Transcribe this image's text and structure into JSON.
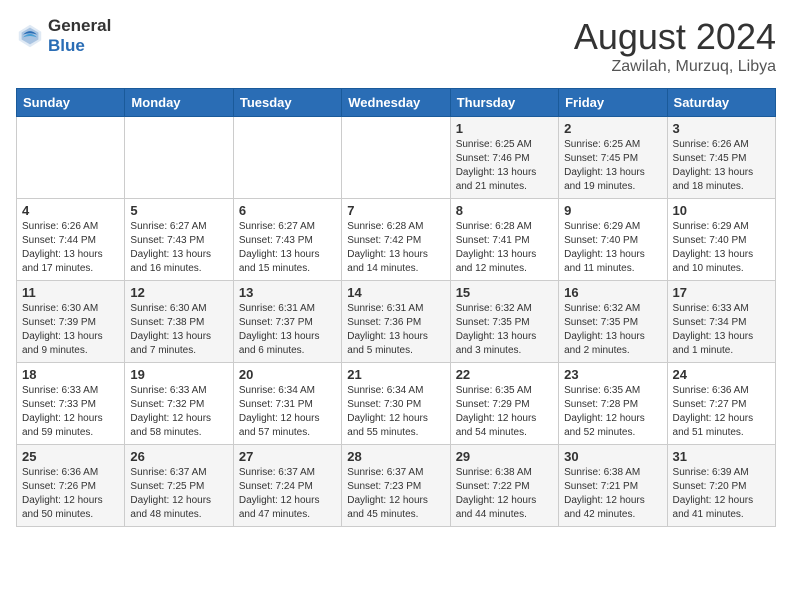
{
  "header": {
    "logo_general": "General",
    "logo_blue": "Blue",
    "month_year": "August 2024",
    "location": "Zawilah, Murzuq, Libya"
  },
  "days_of_week": [
    "Sunday",
    "Monday",
    "Tuesday",
    "Wednesday",
    "Thursday",
    "Friday",
    "Saturday"
  ],
  "weeks": [
    [
      {
        "day": "",
        "info": ""
      },
      {
        "day": "",
        "info": ""
      },
      {
        "day": "",
        "info": ""
      },
      {
        "day": "",
        "info": ""
      },
      {
        "day": "1",
        "info": "Sunrise: 6:25 AM\nSunset: 7:46 PM\nDaylight: 13 hours\nand 21 minutes."
      },
      {
        "day": "2",
        "info": "Sunrise: 6:25 AM\nSunset: 7:45 PM\nDaylight: 13 hours\nand 19 minutes."
      },
      {
        "day": "3",
        "info": "Sunrise: 6:26 AM\nSunset: 7:45 PM\nDaylight: 13 hours\nand 18 minutes."
      }
    ],
    [
      {
        "day": "4",
        "info": "Sunrise: 6:26 AM\nSunset: 7:44 PM\nDaylight: 13 hours\nand 17 minutes."
      },
      {
        "day": "5",
        "info": "Sunrise: 6:27 AM\nSunset: 7:43 PM\nDaylight: 13 hours\nand 16 minutes."
      },
      {
        "day": "6",
        "info": "Sunrise: 6:27 AM\nSunset: 7:43 PM\nDaylight: 13 hours\nand 15 minutes."
      },
      {
        "day": "7",
        "info": "Sunrise: 6:28 AM\nSunset: 7:42 PM\nDaylight: 13 hours\nand 14 minutes."
      },
      {
        "day": "8",
        "info": "Sunrise: 6:28 AM\nSunset: 7:41 PM\nDaylight: 13 hours\nand 12 minutes."
      },
      {
        "day": "9",
        "info": "Sunrise: 6:29 AM\nSunset: 7:40 PM\nDaylight: 13 hours\nand 11 minutes."
      },
      {
        "day": "10",
        "info": "Sunrise: 6:29 AM\nSunset: 7:40 PM\nDaylight: 13 hours\nand 10 minutes."
      }
    ],
    [
      {
        "day": "11",
        "info": "Sunrise: 6:30 AM\nSunset: 7:39 PM\nDaylight: 13 hours\nand 9 minutes."
      },
      {
        "day": "12",
        "info": "Sunrise: 6:30 AM\nSunset: 7:38 PM\nDaylight: 13 hours\nand 7 minutes."
      },
      {
        "day": "13",
        "info": "Sunrise: 6:31 AM\nSunset: 7:37 PM\nDaylight: 13 hours\nand 6 minutes."
      },
      {
        "day": "14",
        "info": "Sunrise: 6:31 AM\nSunset: 7:36 PM\nDaylight: 13 hours\nand 5 minutes."
      },
      {
        "day": "15",
        "info": "Sunrise: 6:32 AM\nSunset: 7:35 PM\nDaylight: 13 hours\nand 3 minutes."
      },
      {
        "day": "16",
        "info": "Sunrise: 6:32 AM\nSunset: 7:35 PM\nDaylight: 13 hours\nand 2 minutes."
      },
      {
        "day": "17",
        "info": "Sunrise: 6:33 AM\nSunset: 7:34 PM\nDaylight: 13 hours\nand 1 minute."
      }
    ],
    [
      {
        "day": "18",
        "info": "Sunrise: 6:33 AM\nSunset: 7:33 PM\nDaylight: 12 hours\nand 59 minutes."
      },
      {
        "day": "19",
        "info": "Sunrise: 6:33 AM\nSunset: 7:32 PM\nDaylight: 12 hours\nand 58 minutes."
      },
      {
        "day": "20",
        "info": "Sunrise: 6:34 AM\nSunset: 7:31 PM\nDaylight: 12 hours\nand 57 minutes."
      },
      {
        "day": "21",
        "info": "Sunrise: 6:34 AM\nSunset: 7:30 PM\nDaylight: 12 hours\nand 55 minutes."
      },
      {
        "day": "22",
        "info": "Sunrise: 6:35 AM\nSunset: 7:29 PM\nDaylight: 12 hours\nand 54 minutes."
      },
      {
        "day": "23",
        "info": "Sunrise: 6:35 AM\nSunset: 7:28 PM\nDaylight: 12 hours\nand 52 minutes."
      },
      {
        "day": "24",
        "info": "Sunrise: 6:36 AM\nSunset: 7:27 PM\nDaylight: 12 hours\nand 51 minutes."
      }
    ],
    [
      {
        "day": "25",
        "info": "Sunrise: 6:36 AM\nSunset: 7:26 PM\nDaylight: 12 hours\nand 50 minutes."
      },
      {
        "day": "26",
        "info": "Sunrise: 6:37 AM\nSunset: 7:25 PM\nDaylight: 12 hours\nand 48 minutes."
      },
      {
        "day": "27",
        "info": "Sunrise: 6:37 AM\nSunset: 7:24 PM\nDaylight: 12 hours\nand 47 minutes."
      },
      {
        "day": "28",
        "info": "Sunrise: 6:37 AM\nSunset: 7:23 PM\nDaylight: 12 hours\nand 45 minutes."
      },
      {
        "day": "29",
        "info": "Sunrise: 6:38 AM\nSunset: 7:22 PM\nDaylight: 12 hours\nand 44 minutes."
      },
      {
        "day": "30",
        "info": "Sunrise: 6:38 AM\nSunset: 7:21 PM\nDaylight: 12 hours\nand 42 minutes."
      },
      {
        "day": "31",
        "info": "Sunrise: 6:39 AM\nSunset: 7:20 PM\nDaylight: 12 hours\nand 41 minutes."
      }
    ]
  ]
}
